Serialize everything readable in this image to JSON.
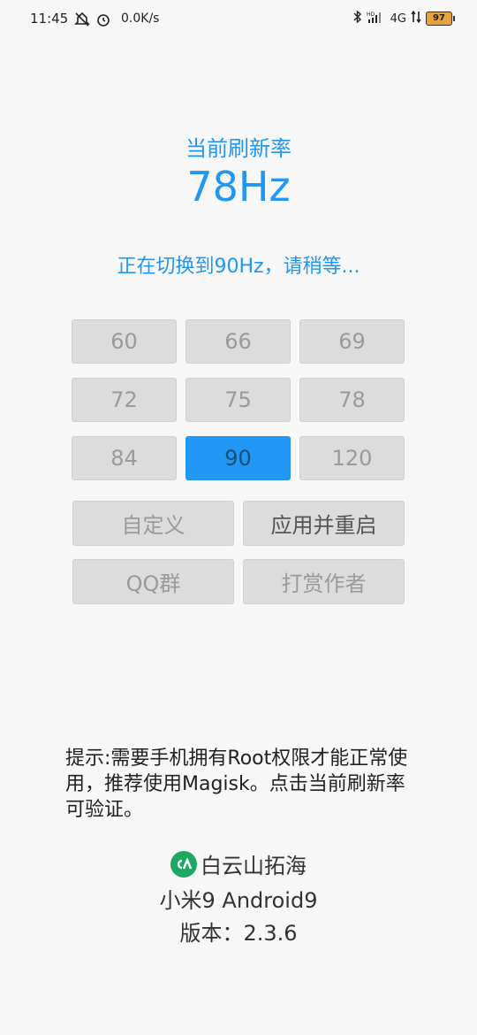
{
  "status_bar": {
    "time": "11:45",
    "net_speed": "0.0K/s",
    "network": "4G",
    "battery": "97"
  },
  "main": {
    "current_rate_label": "当前刷新率",
    "current_rate_value": "78Hz",
    "switching_message": "正在切换到90Hz，请稍等...",
    "rates": [
      "60",
      "66",
      "69",
      "72",
      "75",
      "78",
      "84",
      "90",
      "120"
    ],
    "selected_rate": "90",
    "custom_label": "自定义",
    "apply_restart_label": "应用并重启",
    "qq_group_label": "QQ群",
    "donate_label": "打赏作者"
  },
  "footer": {
    "hint": "提示:需要手机拥有Root权限才能正常使用，推荐使用Magisk。点击当前刷新率可验证。",
    "author": "白云山拓海",
    "device": "小米9   Android9",
    "version": "版本：2.3.6"
  },
  "colors": {
    "accent": "#2196f3",
    "button_bg": "#dcdcdc",
    "logo_green": "#1fa864"
  }
}
